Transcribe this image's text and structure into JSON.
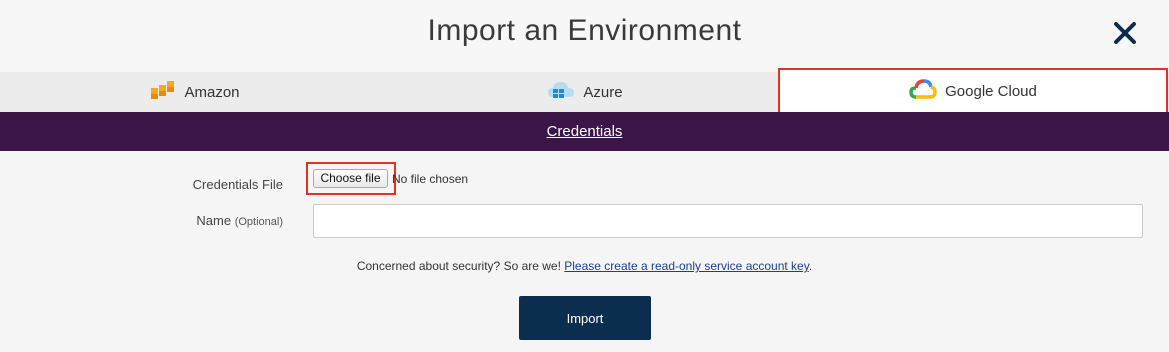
{
  "modal": {
    "title": "Import an Environment",
    "close_icon": "close-icon"
  },
  "tabs": [
    {
      "label": "Amazon",
      "icon": "aws-icon",
      "selected": false
    },
    {
      "label": "Azure",
      "icon": "azure-icon",
      "selected": false
    },
    {
      "label": "Google Cloud",
      "icon": "google-cloud-icon",
      "selected": true
    }
  ],
  "section": {
    "title": "Credentials"
  },
  "form": {
    "credentials_file_label": "Credentials File",
    "choose_file_label": "Choose file",
    "no_file_text": "No file chosen",
    "name_label": "Name",
    "name_optional": "(Optional)",
    "name_value": "",
    "name_placeholder": ""
  },
  "security": {
    "text": "Concerned about security? So are we!",
    "link_text": "Please create a read-only service account key",
    "suffix": "."
  },
  "actions": {
    "import_label": "Import"
  },
  "colors": {
    "section_bar": "#3b1548",
    "import_button": "#0c2e4e",
    "highlight_border": "#e0341f",
    "link": "#1c3f94"
  }
}
